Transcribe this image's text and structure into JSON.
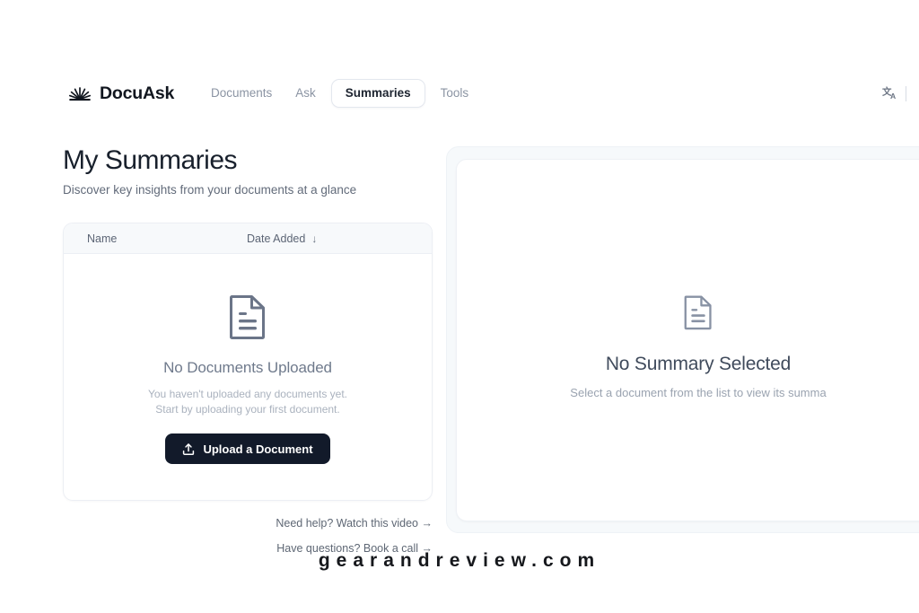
{
  "brand": {
    "name": "DocuAsk",
    "logo_icon": "sunburst-icon"
  },
  "nav": {
    "links": [
      {
        "label": "Documents",
        "active": false
      },
      {
        "label": "Ask",
        "active": false
      },
      {
        "label": "Summaries",
        "active": true
      },
      {
        "label": "Tools",
        "active": false
      }
    ],
    "translate_icon": "translate-icon"
  },
  "page": {
    "title": "My Summaries",
    "subtitle": "Discover key insights from your documents at a glance"
  },
  "list": {
    "columns": {
      "name": "Name",
      "date_added": "Date Added",
      "sort_arrow": "↓"
    },
    "empty": {
      "icon": "document-icon",
      "title": "No Documents Uploaded",
      "line1": "You haven't uploaded any documents yet.",
      "line2": "Start by uploading your first document.",
      "upload_button": "Upload a Document",
      "upload_icon": "upload-icon"
    }
  },
  "help": {
    "video_link": "Need help? Watch this video →",
    "call_link": "Have questions? Book a call →"
  },
  "summary_panel": {
    "icon": "document-icon",
    "title": "No Summary Selected",
    "subtitle": "Select a document from the list to view its summa"
  },
  "watermark": {
    "text": "gearandreview.com"
  },
  "colors": {
    "button_dark": "#121a2a",
    "text_primary": "#18202c",
    "text_muted": "#8b94a3",
    "panel_bg": "#f6f9fb"
  }
}
